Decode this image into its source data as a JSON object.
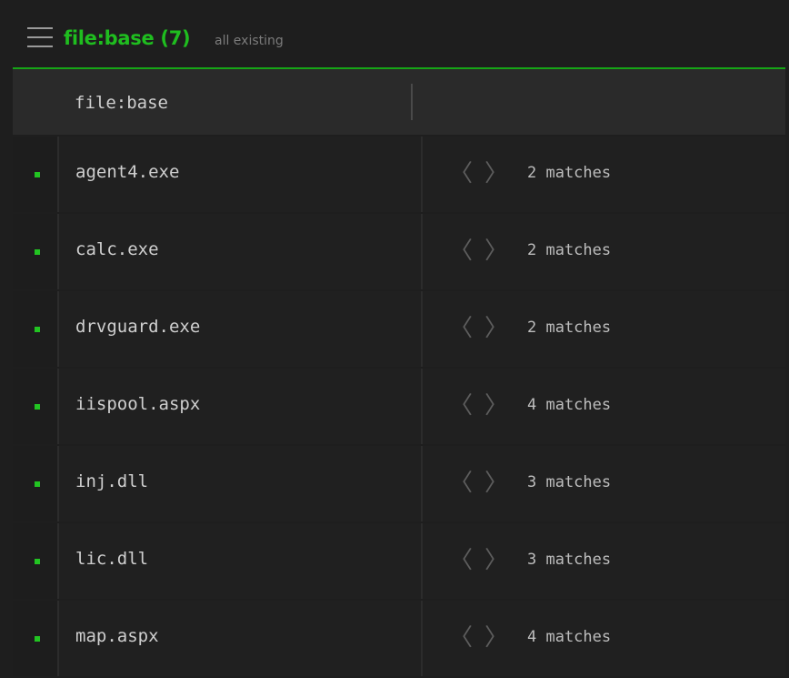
{
  "header": {
    "title": "file:base (7)",
    "subtitle": "all existing"
  },
  "columns": {
    "name_label": "file:base"
  },
  "icons": {
    "menu": "hamburger-menu-icon",
    "prev": "chevron-left-icon",
    "next": "chevron-right-icon",
    "status": "status-dot-icon"
  },
  "glyphs": {
    "prev": "〈",
    "next": "〉"
  },
  "colors": {
    "accent": "#1fbd1f",
    "background": "#1e1e1e",
    "row": "#202020",
    "text": "#cfcfcf",
    "muted": "#7b7b7b"
  },
  "rows": [
    {
      "name": "agent4.exe",
      "matches": "2 matches"
    },
    {
      "name": "calc.exe",
      "matches": "2 matches"
    },
    {
      "name": "drvguard.exe",
      "matches": "2 matches"
    },
    {
      "name": "iispool.aspx",
      "matches": "4 matches"
    },
    {
      "name": "inj.dll",
      "matches": "3 matches"
    },
    {
      "name": "lic.dll",
      "matches": "3 matches"
    },
    {
      "name": "map.aspx",
      "matches": "4 matches"
    }
  ]
}
